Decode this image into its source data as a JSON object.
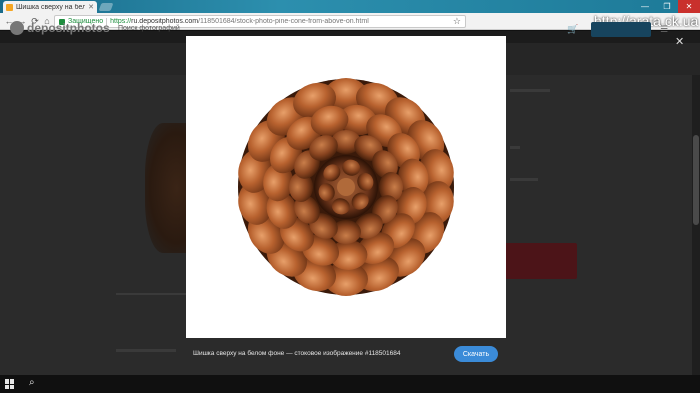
{
  "browser": {
    "tab_title": "Шишка сверху на бел...",
    "tab_close": "✕",
    "window_controls": [
      "—",
      "❐",
      "✕"
    ],
    "nav": {
      "back": "←",
      "forward": "→",
      "reload": "⟳",
      "home": "⌂"
    },
    "secure_label": "Защищено",
    "url_scheme": "https://",
    "url_host": "ru.depositphotos.com",
    "url_path": "/118501684/stock-photo-pine-cone-from-above-on.html",
    "star": "☆",
    "icons": [
      "favicon",
      "lock-icon",
      "star-icon",
      "back-icon",
      "forward-icon",
      "reload-icon",
      "home-icon"
    ]
  },
  "watermark": "http://arata.ck.ua",
  "site": {
    "logo_text": "depositphotos",
    "search_hint": "Поиск фотографий",
    "cart": "🛒",
    "menu": "☰"
  },
  "lightbox": {
    "close": "✕",
    "caption": "Шишка сверху на белом фоне — стоковое изображение #118501684",
    "download_label": "Скачать",
    "colors": {
      "download": "#3b8bd8",
      "caption_bg": "#2b2b2b"
    }
  },
  "taskbar": {
    "icons": [
      "windows-start-icon",
      "search-icon"
    ],
    "search_glyph": "⌕"
  }
}
